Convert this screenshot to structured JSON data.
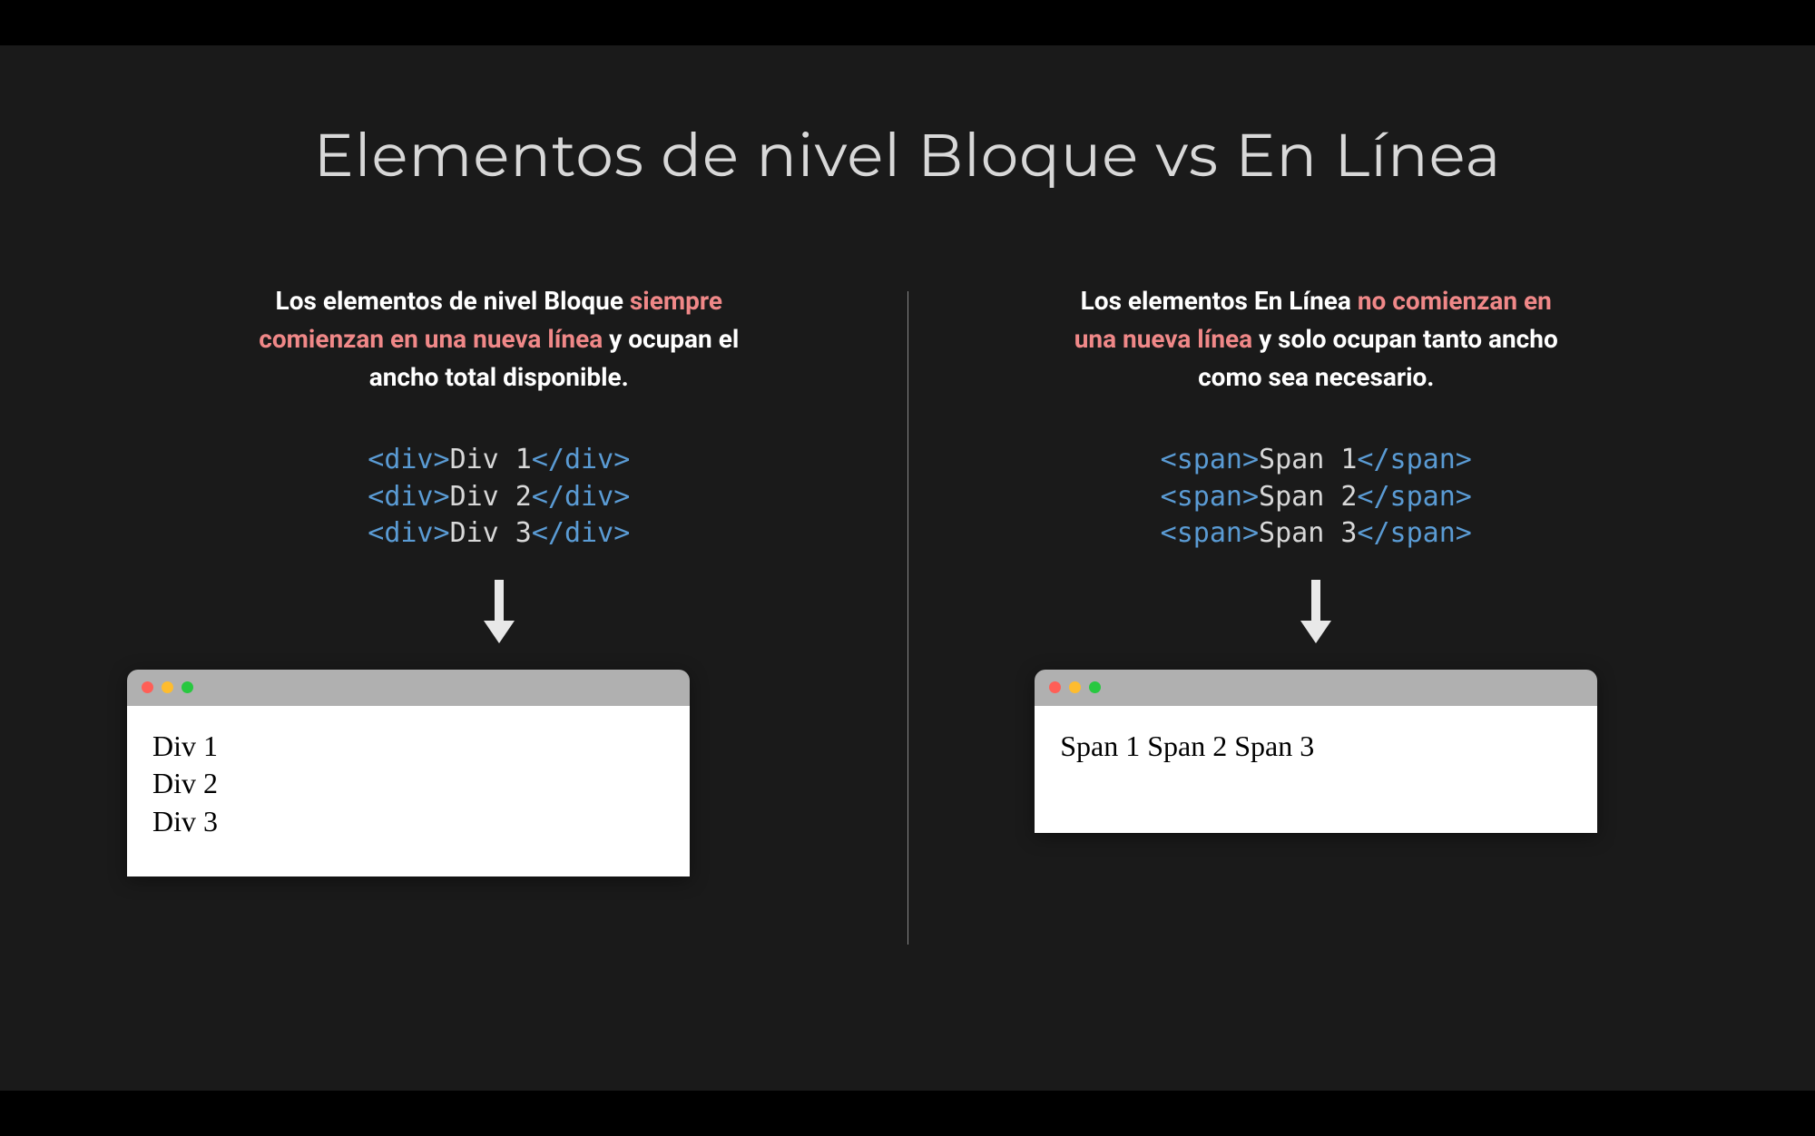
{
  "title": "Elementos de nivel Bloque vs En Línea",
  "left": {
    "desc_pre": "Los elementos de nivel Bloque ",
    "desc_hl": "siempre comienzan en una nueva línea",
    "desc_post": " y ocupan el ancho total disponible.",
    "code": [
      {
        "tag": "div",
        "text": "Div 1"
      },
      {
        "tag": "div",
        "text": "Div 2"
      },
      {
        "tag": "div",
        "text": "Div 3"
      }
    ],
    "output": [
      "Div 1",
      "Div 2",
      "Div 3"
    ]
  },
  "right": {
    "desc_pre": "Los elementos En Línea ",
    "desc_hl": "no comienzan en una nueva línea",
    "desc_post": " y solo ocupan tanto ancho como sea necesario.",
    "code": [
      {
        "tag": "span",
        "text": "Span 1"
      },
      {
        "tag": "span",
        "text": "Span 2"
      },
      {
        "tag": "span",
        "text": "Span 3"
      }
    ],
    "output": [
      "Span 1",
      "Span 2",
      "Span 3"
    ]
  }
}
